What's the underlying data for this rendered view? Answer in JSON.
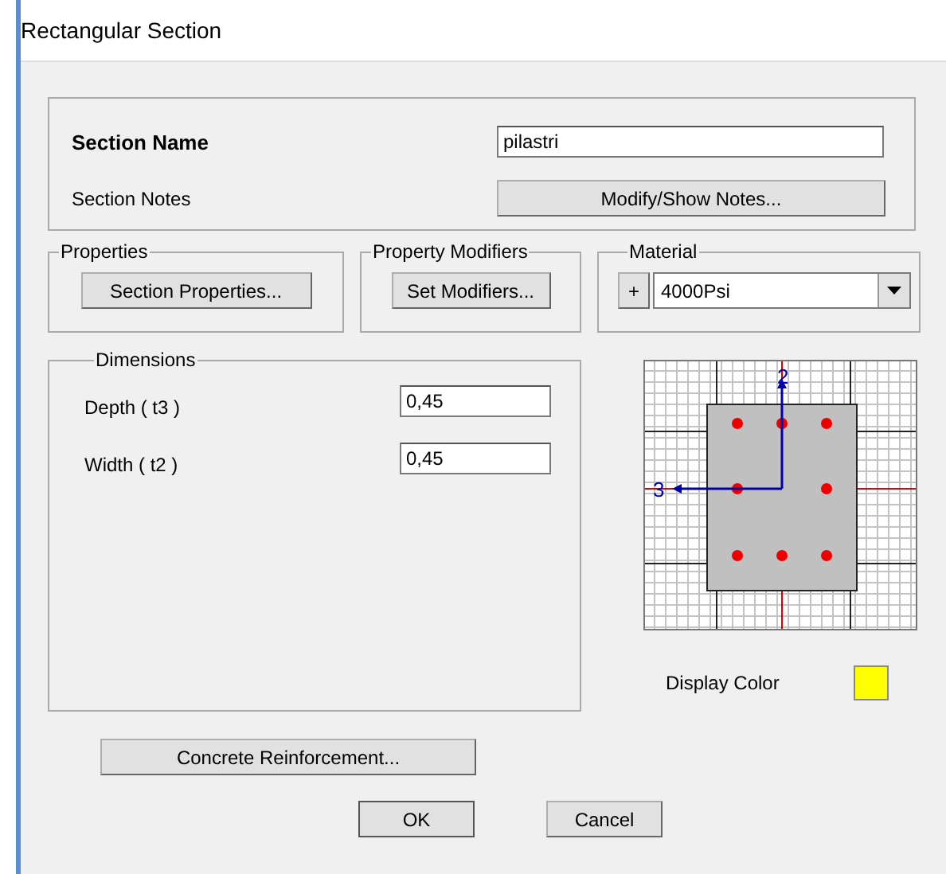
{
  "window": {
    "title": "Rectangular Section"
  },
  "section_name": {
    "label": "Section Name",
    "value": "pilastri"
  },
  "section_notes": {
    "label": "Section Notes",
    "button": "Modify/Show Notes..."
  },
  "properties": {
    "title": "Properties",
    "button": "Section Properties..."
  },
  "property_modifiers": {
    "title": "Property Modifiers",
    "button": "Set Modifiers..."
  },
  "material": {
    "title": "Material",
    "add_button": "+",
    "value": "4000Psi"
  },
  "dimensions": {
    "title": "Dimensions",
    "fields": [
      {
        "label": "Depth  ( t3 )",
        "value": "0,45"
      },
      {
        "label": "Width  ( t2 )",
        "value": "0,45"
      }
    ]
  },
  "section_preview": {
    "axis_labels": [
      "2",
      "3"
    ]
  },
  "display_color": {
    "label": "Display Color",
    "color": "#ffff00"
  },
  "buttons": [
    "Concrete Reinforcement...",
    "OK",
    "Cancel"
  ]
}
